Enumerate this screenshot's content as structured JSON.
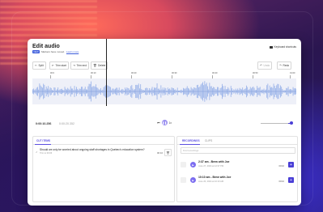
{
  "dialog": {
    "title": "Edit audio",
    "shortcut_label": "Keyboard shortcuts",
    "badge": "NEW",
    "notice": "Markers have moved.",
    "learn_more": "Learn more"
  },
  "toolbar": {
    "split": "Split",
    "trim_start": "Trim start",
    "trim_end": "Trim end",
    "delete": "Delete",
    "undo": "Undo",
    "redo": "Redo"
  },
  "ruler_ticks": [
    "00:0",
    "00:10",
    "00:20",
    "00:30",
    "00:40",
    "00:50",
    "01:00"
  ],
  "player": {
    "current_time": "0:00:10.256",
    "total_time": "0:00:20.352",
    "speed": "1x",
    "volume": 0.9
  },
  "cut_items": {
    "tab_label": "CUT ITEMS",
    "items": [
      {
        "question": "Should we only be worried about ongoing staff shortages in Quebec's education system?",
        "meta": "Trim to 00:06",
        "duration": "00:10"
      }
    ]
  },
  "recordings": {
    "tab_label": "RECORDINGS",
    "clips_label": "CLIPS",
    "search_placeholder": "Find recordings",
    "items": [
      {
        "title": "2:37 am - Brew with Joe",
        "date": "June 27, 2024 at 12:37 PM",
        "length": "00:10"
      },
      {
        "title": "10:10 am - Brew with Joe",
        "date": "June 20, 2024 at 10:10 AM",
        "length": "00:10"
      }
    ]
  },
  "colors": {
    "accent": "#4a3fd6",
    "waveform": "#9fb6ea"
  }
}
